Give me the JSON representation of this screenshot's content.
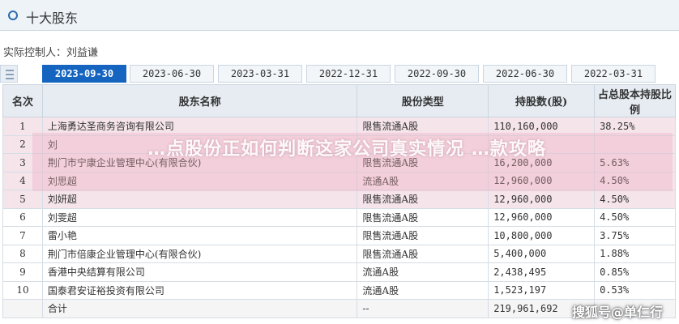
{
  "header": {
    "title": "十大股东"
  },
  "controller": "实际控制人：刘益谦",
  "tabs": [
    {
      "label": "2023-09-30",
      "active": true
    },
    {
      "label": "2023-06-30",
      "active": false
    },
    {
      "label": "2023-03-31",
      "active": false
    },
    {
      "label": "2022-12-31",
      "active": false
    },
    {
      "label": "2022-09-30",
      "active": false
    },
    {
      "label": "2022-06-30",
      "active": false
    },
    {
      "label": "2022-03-31",
      "active": false
    }
  ],
  "table": {
    "columns": [
      "名次",
      "股东名称",
      "股份类型",
      "持股数(股)",
      "占总股本持股比例"
    ],
    "rows": [
      {
        "rank": "1",
        "name": "上海勇达圣商务咨询有限公司",
        "type": "限售流通A股",
        "shares": "110,160,000",
        "pct": "38.25%"
      },
      {
        "rank": "2",
        "name": "刘",
        "type": "",
        "shares": "",
        "pct": ""
      },
      {
        "rank": "3",
        "name": "荆门市宁康企业管理中心(有限合伙)",
        "type": "限售流通A股",
        "shares": "16,200,000",
        "pct": "5.63%"
      },
      {
        "rank": "4",
        "name": "刘思超",
        "type": "流通A股",
        "shares": "12,960,000",
        "pct": "4.50%"
      },
      {
        "rank": "5",
        "name": "刘妍超",
        "type": "限售流通A股",
        "shares": "12,960,000",
        "pct": "4.50%"
      },
      {
        "rank": "6",
        "name": "刘雯超",
        "type": "限售流通A股",
        "shares": "12,960,000",
        "pct": "4.50%"
      },
      {
        "rank": "7",
        "name": "雷小艳",
        "type": "限售流通A股",
        "shares": "10,800,000",
        "pct": "3.75%"
      },
      {
        "rank": "8",
        "name": "荆门市倍康企业管理中心(有限合伙)",
        "type": "限售流通A股",
        "shares": "5,400,000",
        "pct": "1.88%"
      },
      {
        "rank": "9",
        "name": "香港中央结算有限公司",
        "type": "流通A股",
        "shares": "2,438,495",
        "pct": "0.85%"
      },
      {
        "rank": "10",
        "name": "国泰君安证裕投资有限公司",
        "type": "流通A股",
        "shares": "1,523,197",
        "pct": "0.53%"
      }
    ],
    "total": {
      "label": "合计",
      "type": "--",
      "shares": "219,961,692"
    }
  },
  "overlay_text": "…点股份正如何判断这家公司真实情况 …款攻略",
  "watermark": "搜狐号@单仁行"
}
